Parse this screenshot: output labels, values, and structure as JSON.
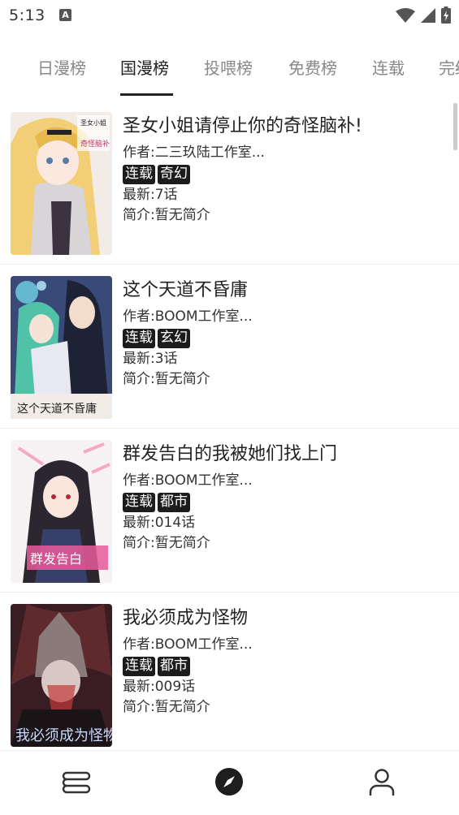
{
  "status_bar": {
    "time": "5:13"
  },
  "tabs": [
    {
      "label": "日漫榜"
    },
    {
      "label": "国漫榜",
      "active": true
    },
    {
      "label": "投喂榜"
    },
    {
      "label": "免费榜"
    },
    {
      "label": "连载"
    },
    {
      "label": "完结"
    }
  ],
  "comics": [
    {
      "title": "圣女小姐请停止你的奇怪脑补!",
      "author_label": "作者: ",
      "author": "二三玖陆工作室...",
      "tags": [
        "连载",
        "奇幻"
      ],
      "latest_label": "最新: ",
      "latest": "7话",
      "intro_label": "简介: ",
      "intro": "暂无简介"
    },
    {
      "title": "这个天道不昏庸",
      "author_label": "作者: ",
      "author": "BOOM工作室...",
      "tags": [
        "连载",
        "玄幻"
      ],
      "latest_label": "最新: ",
      "latest": "3话",
      "intro_label": "简介: ",
      "intro": "暂无简介"
    },
    {
      "title": "群发告白的我被她们找上门",
      "author_label": "作者: ",
      "author": "BOOM工作室...",
      "tags": [
        "连载",
        "都市"
      ],
      "latest_label": "最新: ",
      "latest": "014话",
      "intro_label": "简介: ",
      "intro": "暂无简介"
    },
    {
      "title": "我必须成为怪物",
      "author_label": "作者: ",
      "author": "BOOM工作室...",
      "tags": [
        "连载",
        "都市"
      ],
      "latest_label": "最新: ",
      "latest": "009话",
      "intro_label": "简介: ",
      "intro": "暂无简介"
    }
  ],
  "bottom_nav": [
    {
      "icon": "bookshelf-icon"
    },
    {
      "icon": "compass-icon",
      "active": true
    },
    {
      "icon": "profile-icon"
    }
  ]
}
